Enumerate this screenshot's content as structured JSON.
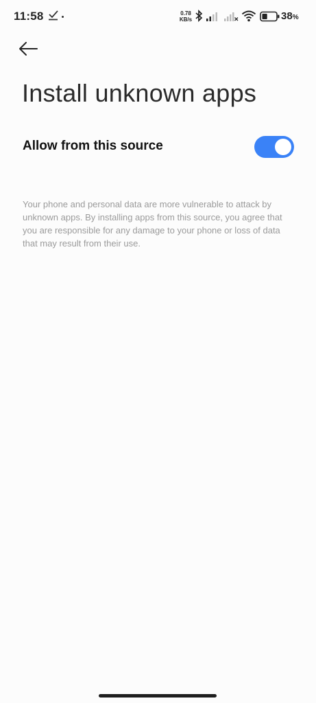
{
  "status_bar": {
    "time": "11:58",
    "net_speed_value": "0.78",
    "net_speed_unit": "KB/s",
    "battery_percent": "38",
    "battery_unit": "%",
    "battery_level": 0.38
  },
  "header": {
    "title": "Install unknown apps"
  },
  "setting": {
    "label": "Allow from this source",
    "enabled": true,
    "accent_color": "#3a82f7"
  },
  "disclaimer": "Your phone and personal data are more vulnerable to attack by unknown apps. By installing apps from this source, you agree that you are responsible for any damage to your phone or loss of data that may result from their use.",
  "icons": [
    "check-download-icon",
    "bluetooth-icon",
    "signal-icon",
    "wifi-icon",
    "battery-icon",
    "back-arrow-icon"
  ]
}
